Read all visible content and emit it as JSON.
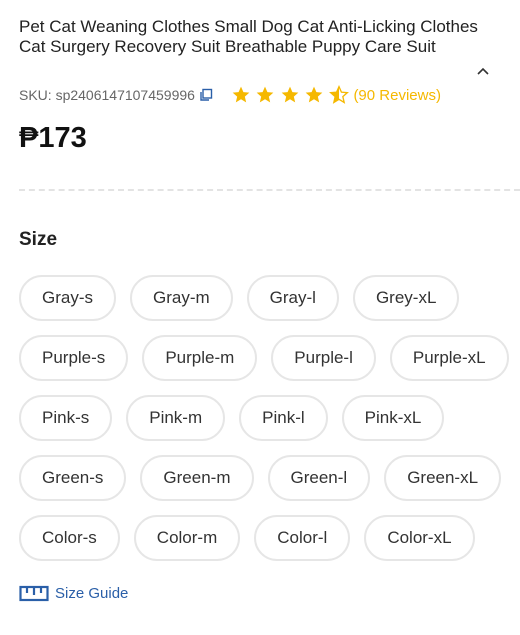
{
  "product": {
    "title": "Pet Cat Weaning Clothes Small Dog Cat Anti-Licking Clothes Cat Surgery Recovery Suit Breathable Puppy Care Suit",
    "sku": "SKU: sp2406147107459996",
    "rating": 4.5,
    "reviews": "(90 Reviews)",
    "price": "₱173"
  },
  "icons": {
    "collapse": "chevron-up-icon",
    "copy": "copy-icon",
    "star": "star-icon",
    "size_guide": "ruler-icon"
  },
  "colors": {
    "star": "#f5b800",
    "link": "#2a5fa8"
  },
  "size": {
    "heading": "Size",
    "rows": [
      [
        "Gray-s",
        "Gray-m",
        "Gray-l",
        "Grey-xL"
      ],
      [
        "Purple-s",
        "Purple-m",
        "Purple-l",
        "Purple-xL"
      ],
      [
        "Pink-s",
        "Pink-m",
        "Pink-l",
        "Pink-xL"
      ],
      [
        "Green-s",
        "Green-m",
        "Green-l",
        "Green-xL"
      ],
      [
        "Color-s",
        "Color-m",
        "Color-l",
        "Color-xL"
      ]
    ],
    "guide_label": "Size Guide"
  }
}
